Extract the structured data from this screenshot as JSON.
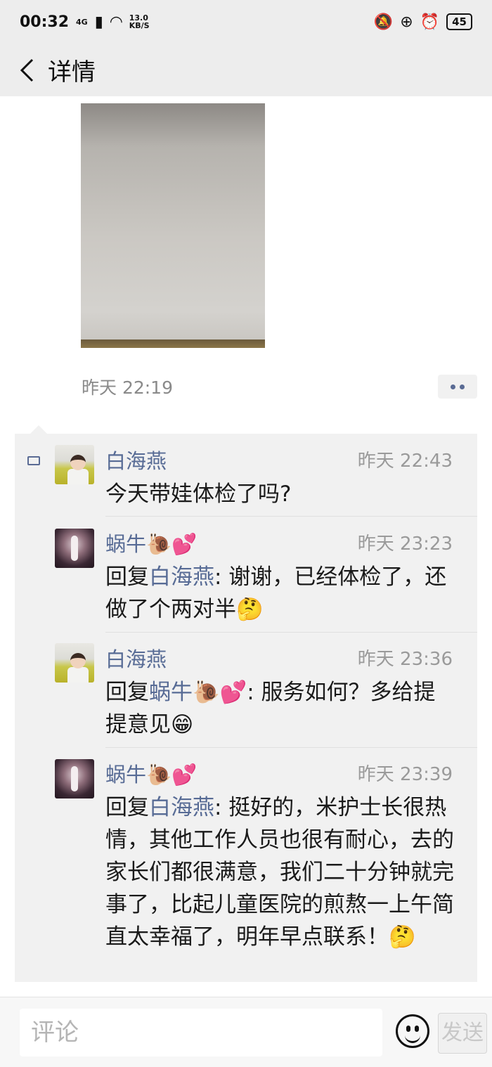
{
  "status_bar": {
    "time": "00:32",
    "network": "4G",
    "speed_value": "13.0",
    "speed_unit": "KB/S",
    "battery": "45"
  },
  "nav": {
    "title": "详情"
  },
  "post": {
    "time": "昨天 22:19"
  },
  "comments": [
    {
      "name": "白海燕",
      "time": "昨天 22:43",
      "text": "今天带娃体检了吗?"
    },
    {
      "name": "蜗牛🐌💕",
      "time": "昨天 23:23",
      "reply_prefix": "回复",
      "reply_to": "白海燕",
      "text": ": 谢谢，已经体检了，还做了个两对半🤔"
    },
    {
      "name": "白海燕",
      "time": "昨天 23:36",
      "reply_prefix": "回复",
      "reply_to": "蜗牛🐌💕",
      "text": ": 服务如何？多给提提意见😁"
    },
    {
      "name": "蜗牛🐌💕",
      "time": "昨天 23:39",
      "reply_prefix": "回复",
      "reply_to": "白海燕",
      "text": ": 挺好的，米护士长很热情，其他工作人员也很有耐心，去的家长们都很满意，我们二十分钟就完事了，比起儿童医院的煎熬一上午简直太幸福了，明年早点联系！🤔"
    }
  ],
  "bottom_bar": {
    "placeholder": "评论",
    "send_label": "发送"
  },
  "colors": {
    "link": "#576b95",
    "background_bar": "#ededed",
    "comment_area": "#f1f1f1"
  }
}
